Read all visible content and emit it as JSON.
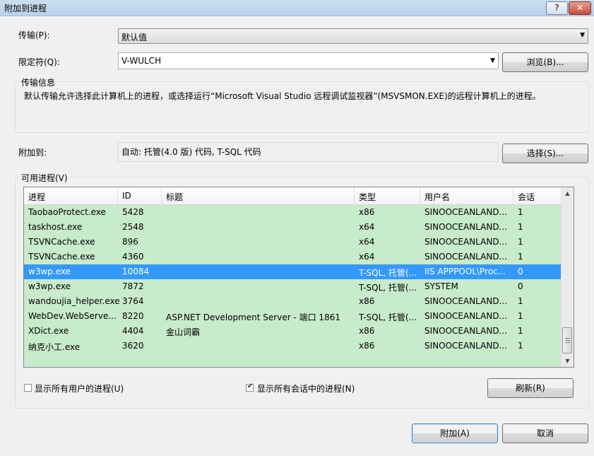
{
  "window": {
    "title": "附加到进程",
    "help_label": "?",
    "close_label": "✕"
  },
  "transport": {
    "label": "传输(P):",
    "value": "默认值"
  },
  "qualifier": {
    "label": "限定符(Q):",
    "value": "V-WULCH",
    "browse_label": "浏览(B)..."
  },
  "transport_info": {
    "group_label": "传输信息",
    "text": "默认传输允许选择此计算机上的进程，或选择运行“Microsoft Visual Studio 远程调试监视器”(MSVSMON.EXE)的远程计算机上的进程。"
  },
  "attach_to": {
    "label": "附加到:",
    "value": "自动: 托管(4.0 版) 代码, T-SQL 代码",
    "select_label": "选择(S)..."
  },
  "processes": {
    "group_label": "可用进程(V)",
    "columns": [
      "进程",
      "ID",
      "标题",
      "类型",
      "用户名",
      "会话"
    ],
    "rows": [
      [
        "TaobaoProtect.exe",
        "5428",
        "",
        "x86",
        "SINOOCEANLAND...",
        "1"
      ],
      [
        "taskhost.exe",
        "2548",
        "",
        "x64",
        "SINOOCEANLAND...",
        "1"
      ],
      [
        "TSVNCache.exe",
        "896",
        "",
        "x64",
        "SINOOCEANLAND...",
        "1"
      ],
      [
        "TSVNCache.exe",
        "4360",
        "",
        "x64",
        "SINOOCEANLAND...",
        "1"
      ],
      [
        "w3wp.exe",
        "10084",
        "",
        "T-SQL, 托管(...",
        "IIS APPPOOL\\Proc...",
        "0"
      ],
      [
        "w3wp.exe",
        "7872",
        "",
        "T-SQL, 托管(...",
        "SYSTEM",
        "0"
      ],
      [
        "wandoujia_helper.exe",
        "3764",
        "",
        "x86",
        "SINOOCEANLAND...",
        "1"
      ],
      [
        "WebDev.WebServe...",
        "8220",
        "ASP.NET Development Server - 端口 1861",
        "T-SQL, 托管(...",
        "SINOOCEANLAND...",
        "1"
      ],
      [
        "XDict.exe",
        "4404",
        "金山词霸",
        "x86",
        "SINOOCEANLAND...",
        "1"
      ],
      [
        "纳克小工.exe",
        "3620",
        "",
        "x86",
        "SINOOCEANLAND...",
        "1"
      ]
    ],
    "show_all_users": {
      "label": "显示所有用户的进程(U)",
      "checked": false
    },
    "show_all_sessions": {
      "label": "显示所有会话中的进程(N)",
      "checked": true
    },
    "refresh_label": "刷新(R)"
  },
  "footer": {
    "attach_label": "附加(A)",
    "cancel_label": "取消"
  },
  "colors": {
    "list_bg": "#c8ebcb",
    "selection": "#3399ff"
  }
}
